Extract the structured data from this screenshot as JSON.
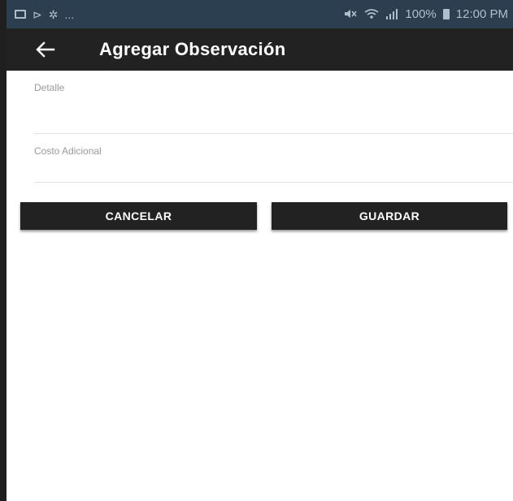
{
  "status_bar": {
    "left_icons": [
      "image-icon",
      "send-icon",
      "brightness-icon"
    ],
    "left_ellipsis": "...",
    "battery_percent": "100%",
    "time": "12:00 PM"
  },
  "toolbar": {
    "title": "Agregar Observación",
    "back_icon": "arrow-back-icon"
  },
  "form": {
    "detalle_label": "Detalle",
    "detalle_value": "",
    "costo_label": "Costo Adicional",
    "costo_value": ""
  },
  "buttons": {
    "cancel_label": "CANCELAR",
    "save_label": "GUARDAR"
  },
  "colors": {
    "status_bar": "#2b3f50",
    "toolbar": "#222222",
    "button": "#222222"
  }
}
